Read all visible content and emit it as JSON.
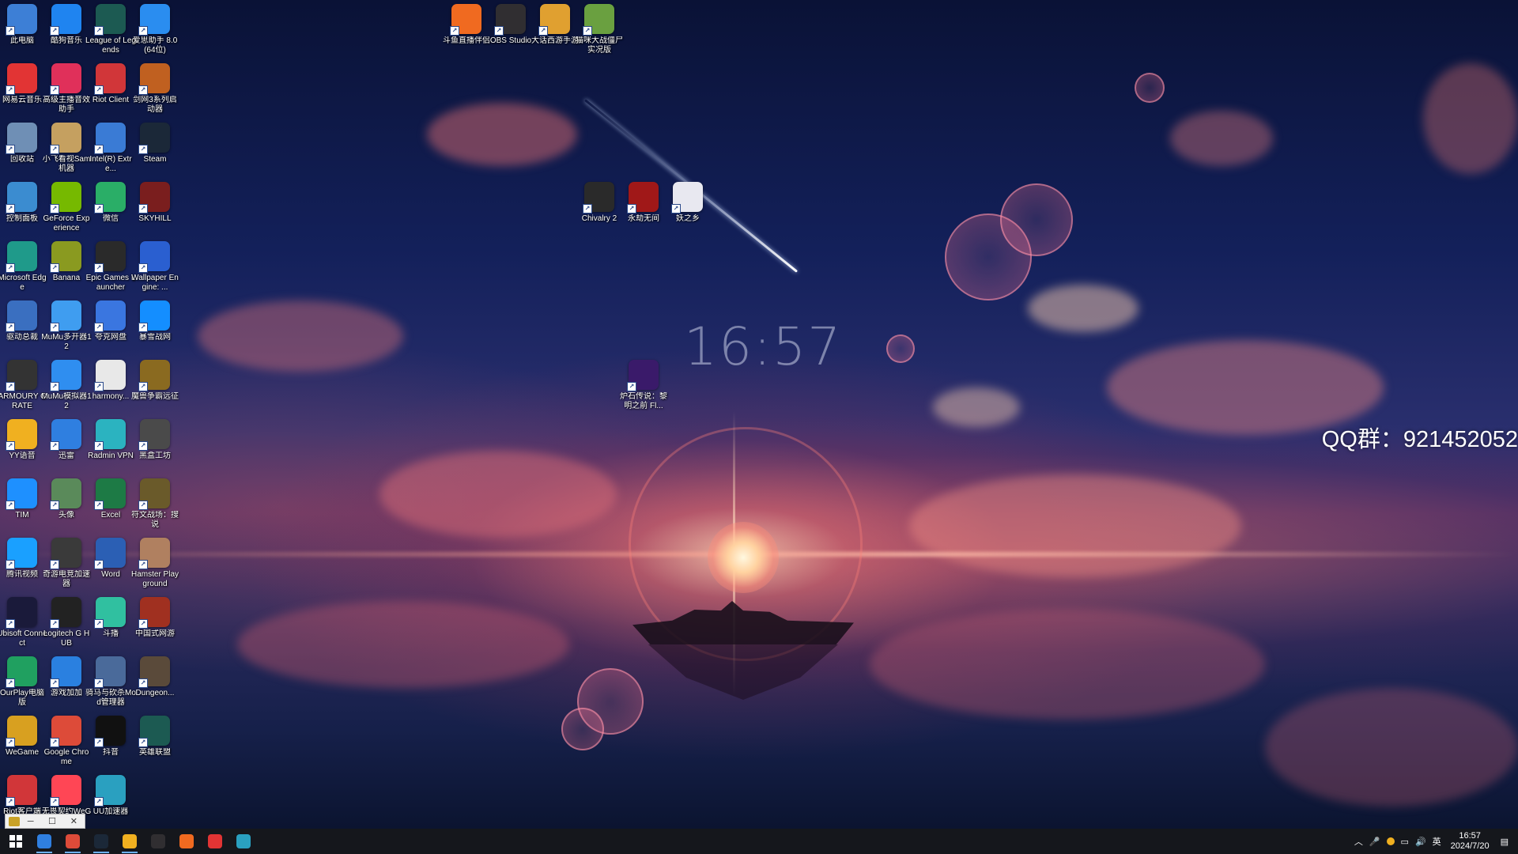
{
  "desktop": {
    "clock_overlay": "16:57",
    "qq_text": "QQ群：921452052",
    "icons": [
      {
        "label": "此电脑",
        "icon": "computer-icon",
        "color": "#3d7fd6"
      },
      {
        "label": "酷狗音乐",
        "icon": "kugou-icon",
        "color": "#1f84f0"
      },
      {
        "label": "League of Legends",
        "icon": "lol-icon",
        "color": "#1c5a52"
      },
      {
        "label": "爱思助手 8.0(64位)",
        "icon": "i4-icon",
        "color": "#2a8df0"
      },
      {
        "label": "网易云音乐",
        "icon": "netease-music-icon",
        "color": "#e23434"
      },
      {
        "label": "高级主播音效助手",
        "icon": "audio-assistant-icon",
        "color": "#e0305a"
      },
      {
        "label": "Riot Client",
        "icon": "riot-icon",
        "color": "#d13639"
      },
      {
        "label": "剑网3系列启动器",
        "icon": "jx3-icon",
        "color": "#c06020"
      },
      {
        "label": "回收站",
        "icon": "recycle-bin-icon",
        "color": "#6f8fb5"
      },
      {
        "label": "小飞看视Sam机器",
        "icon": "sam-icon",
        "color": "#c5a060"
      },
      {
        "label": "Intel(R) Extre...",
        "icon": "intel-icon",
        "color": "#3a7bd5"
      },
      {
        "label": "Steam",
        "icon": "steam-icon",
        "color": "#1b2838"
      },
      {
        "label": "控制面板",
        "icon": "control-panel-icon",
        "color": "#3b8cd0"
      },
      {
        "label": "GeForce Experience",
        "icon": "geforce-icon",
        "color": "#76b900"
      },
      {
        "label": "微信",
        "icon": "wechat-icon",
        "color": "#2aae67"
      },
      {
        "label": "SKYHILL",
        "icon": "skyhill-icon",
        "color": "#7a1e1e"
      },
      {
        "label": "Microsoft Edge",
        "icon": "edge-icon",
        "color": "#1f9a8a"
      },
      {
        "label": "Banana",
        "icon": "banana-icon",
        "color": "#8a9a20"
      },
      {
        "label": "Epic Games Launcher",
        "icon": "epic-icon",
        "color": "#2a2a2a"
      },
      {
        "label": "Wallpaper Engine: ...",
        "icon": "wallpaper-engine-icon",
        "color": "#2a5fd0"
      },
      {
        "label": "驱动总裁",
        "icon": "driver-icon",
        "color": "#3a6fc0"
      },
      {
        "label": "MuMu多开器12",
        "icon": "mumu-multi-icon",
        "color": "#3f9df0"
      },
      {
        "label": "夸克网盘",
        "icon": "quark-icon",
        "color": "#3a76e0"
      },
      {
        "label": "暴雪战网",
        "icon": "battlenet-icon",
        "color": "#148eff"
      },
      {
        "label": "ARMOURY CRATE",
        "icon": "armoury-crate-icon",
        "color": "#333333"
      },
      {
        "label": "MuMu模拟器12",
        "icon": "mumu-icon",
        "color": "#2f8ef0"
      },
      {
        "label": "harmony...",
        "icon": "document-icon",
        "color": "#e8e8e8"
      },
      {
        "label": "魔兽争霸远征",
        "icon": "warcraft-icon",
        "color": "#8a6a20"
      },
      {
        "label": "YY语音",
        "icon": "yy-icon",
        "color": "#f0b020"
      },
      {
        "label": "迅雷",
        "icon": "thunder-icon",
        "color": "#2f7fe0"
      },
      {
        "label": "Radmin VPN",
        "icon": "radmin-icon",
        "color": "#2bb3c0"
      },
      {
        "label": "黑盒工坊",
        "icon": "heybox-icon",
        "color": "#4a4a4a"
      },
      {
        "label": "TIM",
        "icon": "tim-icon",
        "color": "#1e90ff"
      },
      {
        "label": "头像",
        "icon": "avatar-file-icon",
        "color": "#5a8a5a"
      },
      {
        "label": "Excel",
        "icon": "excel-icon",
        "color": "#1d7a45"
      },
      {
        "label": "符文战场：搜说",
        "icon": "rune-icon",
        "color": "#6a5a2a"
      },
      {
        "label": "腾讯视频",
        "icon": "tencent-video-icon",
        "color": "#1aa0ff"
      },
      {
        "label": "奇游电竞加速器",
        "icon": "qiyou-icon",
        "color": "#3a3a3a"
      },
      {
        "label": "Word",
        "icon": "word-icon",
        "color": "#2b5fb4"
      },
      {
        "label": "Hamster Playground",
        "icon": "hamster-icon",
        "color": "#b08060"
      },
      {
        "label": "Ubisoft Connect",
        "icon": "ubisoft-icon",
        "color": "#1a1a3a"
      },
      {
        "label": "Logitech G HUB",
        "icon": "ghub-icon",
        "color": "#222222"
      },
      {
        "label": "斗播",
        "icon": "doubo-icon",
        "color": "#30c0a0"
      },
      {
        "label": "中国式网游",
        "icon": "china-mmo-icon",
        "color": "#a03020"
      },
      {
        "label": "OurPlay电脑版",
        "icon": "ourplay-icon",
        "color": "#20a060"
      },
      {
        "label": "游戏加加",
        "icon": "game-plus-icon",
        "color": "#2a80e0"
      },
      {
        "label": "骑马与砍杀Mod管理器",
        "icon": "bannerlord-mod-icon",
        "color": "#4a6a9a"
      },
      {
        "label": "Dungeon...",
        "icon": "dungeon-icon",
        "color": "#5a4a3a"
      },
      {
        "label": "WeGame",
        "icon": "wegame-icon",
        "color": "#d8a020"
      },
      {
        "label": "Google Chrome",
        "icon": "chrome-icon",
        "color": "#dd4b39"
      },
      {
        "label": "抖音",
        "icon": "douyin-icon",
        "color": "#111111"
      },
      {
        "label": "英雄联盟",
        "icon": "lol-cn-icon",
        "color": "#1c5a52"
      },
      {
        "label": "Riot客户端",
        "icon": "riot-client-cn-icon",
        "color": "#d13639"
      },
      {
        "label": "无畏契约WeGame版",
        "icon": "valorant-icon",
        "color": "#ff4655"
      },
      {
        "label": "UU加速器",
        "icon": "uu-icon",
        "color": "#2aa0c0"
      },
      {
        "label": "斗鱼直播伴侣",
        "icon": "douyu-icon",
        "color": "#f06a20"
      },
      {
        "label": "OBS Studio",
        "icon": "obs-icon",
        "color": "#302e31"
      },
      {
        "label": "大话西游手游",
        "icon": "dahua-icon",
        "color": "#e0a030"
      },
      {
        "label": "猫咪大战僵尸实况版",
        "icon": "cat-game-icon",
        "color": "#6aa040"
      },
      {
        "label": "Chivalry 2",
        "icon": "chivalry-icon",
        "color": "#2a2a2a"
      },
      {
        "label": "永劫无间",
        "icon": "naraka-icon",
        "color": "#a01818"
      },
      {
        "label": "妖之乡",
        "icon": "rabbit-game-icon",
        "color": "#e8e8f0"
      },
      {
        "label": "炉石传说：黎明之前 Fl...",
        "icon": "triangle-game-icon",
        "color": "#3a1a6a"
      }
    ]
  },
  "popup": {
    "btn1": "─",
    "btn2": "☐",
    "btn3": "✕"
  },
  "taskbar": {
    "start_label": "开始",
    "items": [
      {
        "icon": "start-icon",
        "color": "#ffffff"
      },
      {
        "icon": "thunder-task-icon",
        "color": "#2f7fe0"
      },
      {
        "icon": "chrome-task-icon",
        "color": "#dd4b39"
      },
      {
        "icon": "steam-task-icon",
        "color": "#1b2838"
      },
      {
        "icon": "yy-task-icon",
        "color": "#f0b020"
      },
      {
        "icon": "obs-task-icon",
        "color": "#302e31"
      },
      {
        "icon": "douyu-task-icon",
        "color": "#f06a20"
      },
      {
        "icon": "netease-task-icon",
        "color": "#e23434"
      },
      {
        "icon": "uu-task-icon",
        "color": "#2aa0c0"
      }
    ],
    "tray": {
      "ime": "英",
      "time": "16:57",
      "date": "2024/7/20"
    }
  }
}
